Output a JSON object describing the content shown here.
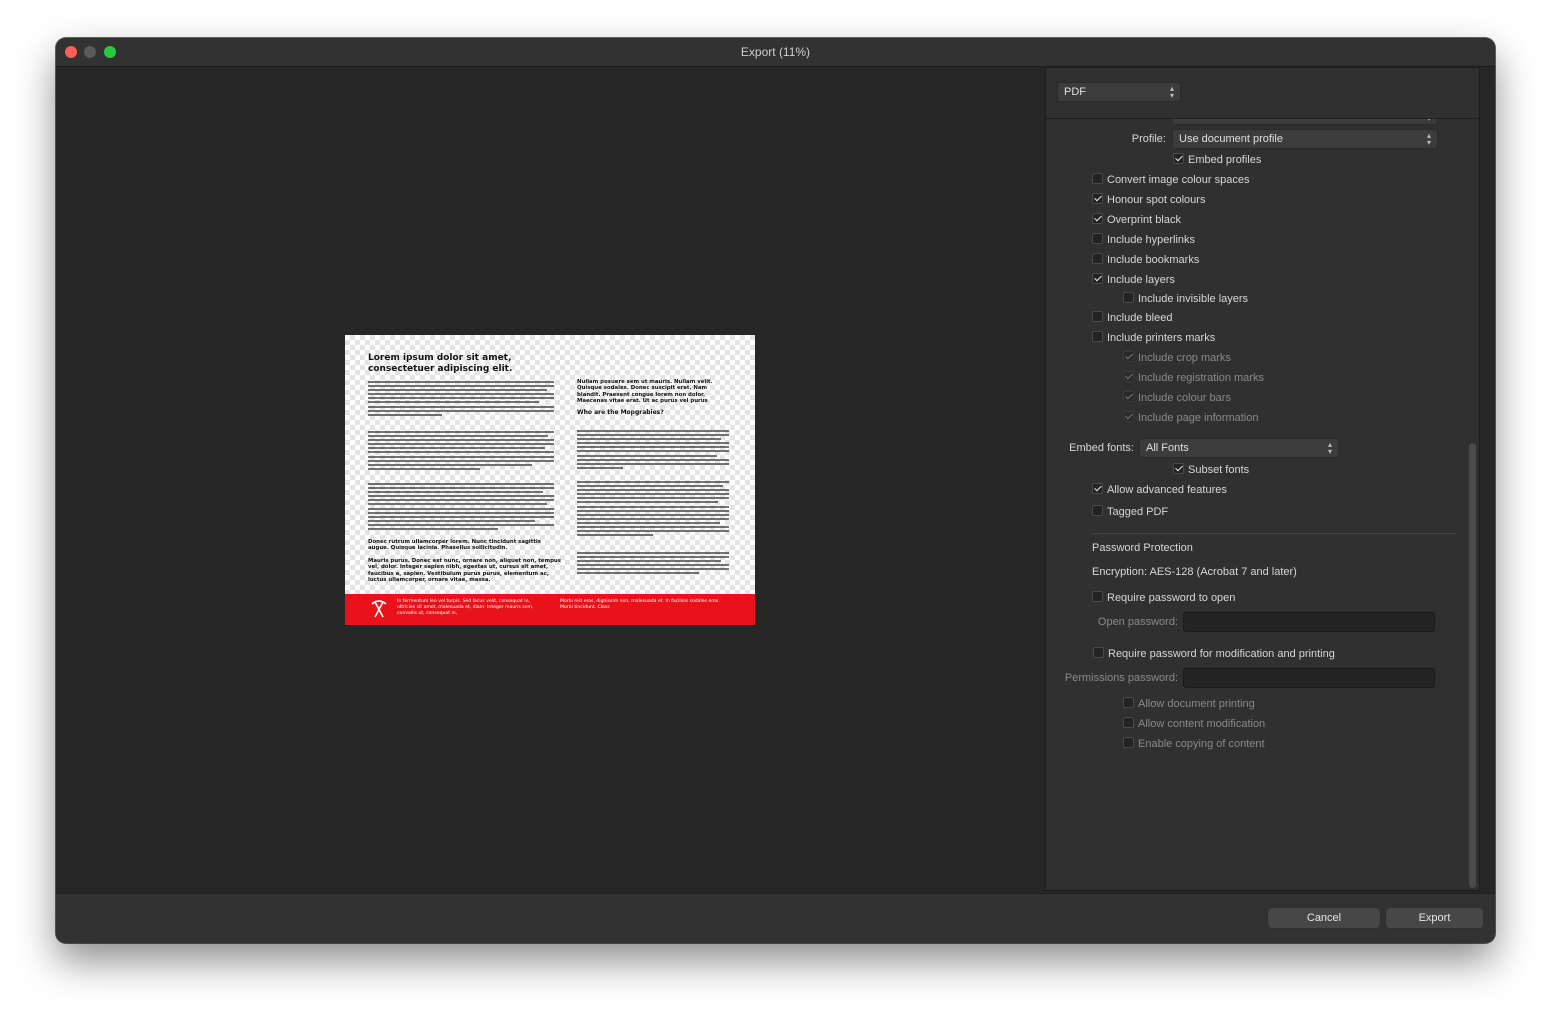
{
  "window": {
    "title": "Export (11%)"
  },
  "format": {
    "selected": "PDF"
  },
  "color": {
    "profile_label": "Profile:",
    "profile_value": "Use document profile",
    "embed_profiles": {
      "label": "Embed profiles",
      "checked": true
    }
  },
  "options": [
    {
      "key": "convert_image_colour_spaces",
      "label": "Convert image colour spaces",
      "checked": false
    },
    {
      "key": "honour_spot_colours",
      "label": "Honour spot colours",
      "checked": true
    },
    {
      "key": "overprint_black",
      "label": "Overprint black",
      "checked": true
    },
    {
      "key": "include_hyperlinks",
      "label": "Include hyperlinks",
      "checked": false
    },
    {
      "key": "include_bookmarks",
      "label": "Include bookmarks",
      "checked": false
    },
    {
      "key": "include_layers",
      "label": "Include layers",
      "checked": true
    },
    {
      "key": "include_invisible_layers",
      "label": "Include invisible layers",
      "checked": false
    },
    {
      "key": "include_bleed",
      "label": "Include bleed",
      "checked": false
    },
    {
      "key": "include_printers_marks",
      "label": "Include printers marks",
      "checked": false
    },
    {
      "key": "include_crop_marks",
      "label": "Include crop marks",
      "checked": true,
      "disabled": true
    },
    {
      "key": "include_registration_marks",
      "label": "Include registration marks",
      "checked": true,
      "disabled": true
    },
    {
      "key": "include_colour_bars",
      "label": "Include colour bars",
      "checked": true,
      "disabled": true
    },
    {
      "key": "include_page_information",
      "label": "Include page information",
      "checked": true,
      "disabled": true
    }
  ],
  "fonts": {
    "embed_label": "Embed fonts:",
    "embed_value": "All Fonts",
    "subset_fonts": {
      "label": "Subset fonts",
      "checked": true
    }
  },
  "advanced": {
    "allow_advanced_features": {
      "label": "Allow advanced features",
      "checked": true
    },
    "tagged_pdf": {
      "label": "Tagged PDF",
      "checked": false
    }
  },
  "security": {
    "heading": "Password Protection",
    "encryption": "Encryption: AES-128 (Acrobat 7 and later)",
    "require_open": {
      "label": "Require password to open",
      "checked": false
    },
    "open_password_label": "Open password:",
    "require_permissions": {
      "label": "Require password for modification and printing",
      "checked": false
    },
    "permissions_password_label": "Permissions password:",
    "allow_printing": {
      "label": "Allow document printing",
      "checked": false
    },
    "allow_modification": {
      "label": "Allow content modification",
      "checked": false
    },
    "allow_copying": {
      "label": "Enable copying of content",
      "checked": false
    }
  },
  "buttons": {
    "cancel": "Cancel",
    "export": "Export"
  },
  "preview": {
    "title": "Lorem ipsum dolor sit amet, consectetuer adipiscing elit.",
    "right_intro": "Nullam posuere sem ut mauris. Nullam velit. Quisque sodales. Donec suscipit erat. Nam blandit. Praesent congue lorem non dolor. Maecenas vitae erat. Ut ac purus vel purus",
    "right_heading": "Who are the Mopgrabies?",
    "left_bold_1": "Donec rutrum ullamcorper lorem. Nunc tincidunt sagittis augue. Quisque lacinia. Phasellus sollicitudin.",
    "left_bold_2": "Mauris purus. Donec est nunc, ornare non, aliquet non, tempus vel, dolor. Integer sapien nibh, egestas ut, cursus sit amet, faucibus a, sapien. Vestibulum purus purus, elementum ac, luctus ullamcorper, ornare vitae, massa.",
    "footer_left": "In fermentum leo vel turpis. Sed lacus velit, consequat in, ultricies sit amet, malesuada et, diam. Integer mauris sem, convallis ut, consequat in,",
    "footer_right": "Morbi nisl eros, dignissim non, malesuada et. In facilisis sodales eros. Morbi tincidunt. Class"
  }
}
